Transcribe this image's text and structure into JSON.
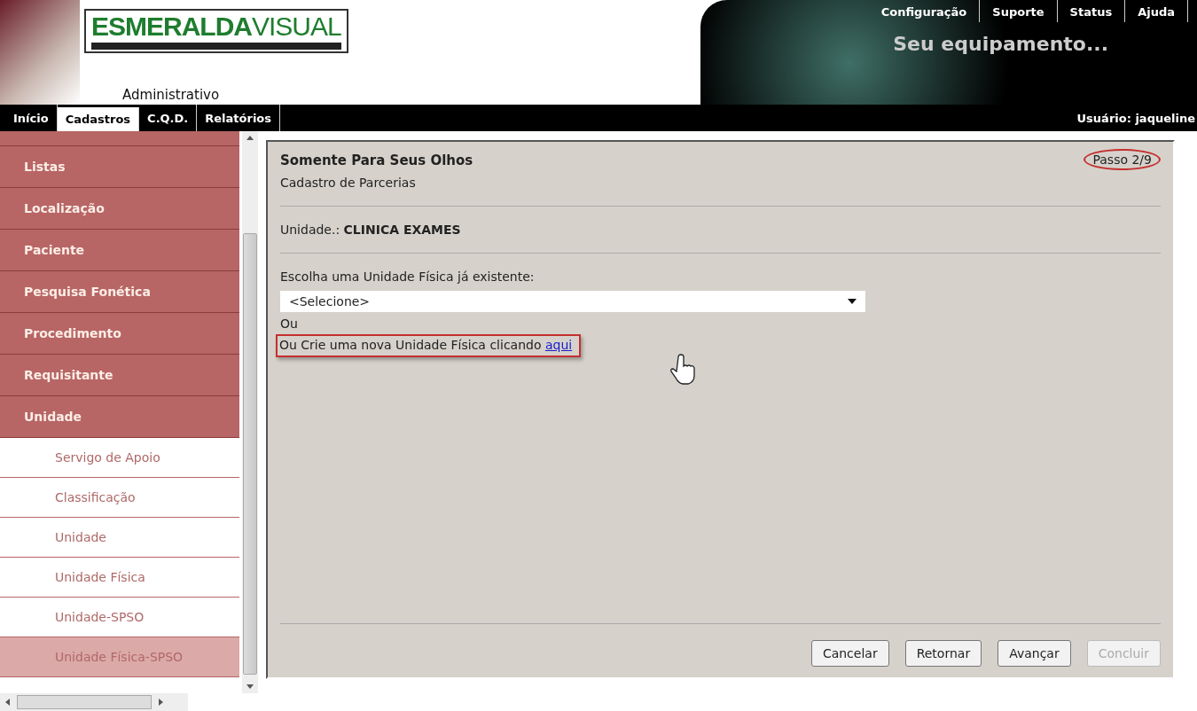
{
  "header": {
    "logo_primary": "ESMERALDA",
    "logo_secondary": "VISUAL",
    "subtitle": "Administrativo",
    "top_links": [
      "Configuração",
      "Suporte",
      "Status",
      "Ajuda"
    ],
    "banner_text": "Seu equipamento..."
  },
  "nav": {
    "tabs": [
      {
        "label": "Início",
        "selected": false
      },
      {
        "label": "Cadastros",
        "selected": true
      },
      {
        "label": "C.Q.D.",
        "selected": false
      },
      {
        "label": "Relatórios",
        "selected": false
      }
    ],
    "user": "Usuário: jaqueline"
  },
  "sidebar": {
    "items": [
      {
        "label": "Listas",
        "kind": "group",
        "selected": false
      },
      {
        "label": "Localização",
        "kind": "group",
        "selected": false
      },
      {
        "label": "Paciente",
        "kind": "group",
        "selected": false
      },
      {
        "label": "Pesquisa Fonética",
        "kind": "group",
        "selected": false
      },
      {
        "label": "Procedimento",
        "kind": "group",
        "selected": false
      },
      {
        "label": "Requisitante",
        "kind": "group",
        "selected": false
      },
      {
        "label": "Unidade",
        "kind": "group",
        "selected": false
      },
      {
        "label": "Servigo de Apoio",
        "kind": "sub",
        "selected": false
      },
      {
        "label": "Classificação",
        "kind": "sub",
        "selected": false
      },
      {
        "label": "Unidade",
        "kind": "sub",
        "selected": false
      },
      {
        "label": "Unidade Física",
        "kind": "sub",
        "selected": false
      },
      {
        "label": "Unidade-SPSO",
        "kind": "sub",
        "selected": false
      },
      {
        "label": "Unidade Física-SPSO",
        "kind": "sub",
        "selected": true
      }
    ]
  },
  "panel": {
    "title": "Somente Para Seus Olhos",
    "subtitle": "Cadastro de Parcerias",
    "step": "Passo 2/9",
    "unit": "Unidade.: **CLINICA EXAMES**",
    "select_label": "Escolha uma Unidade Física já existente:",
    "select_value": "<Selecione>",
    "or_text": "Ou",
    "create_text": "Ou Crie uma nova Unidade Física clicando",
    "create_link": "aqui",
    "buttons": [
      {
        "label": "Cancelar",
        "disabled": false
      },
      {
        "label": "Retornar",
        "disabled": false
      },
      {
        "label": "Avançar",
        "disabled": false
      },
      {
        "label": "Concluir",
        "disabled": true
      }
    ]
  }
}
